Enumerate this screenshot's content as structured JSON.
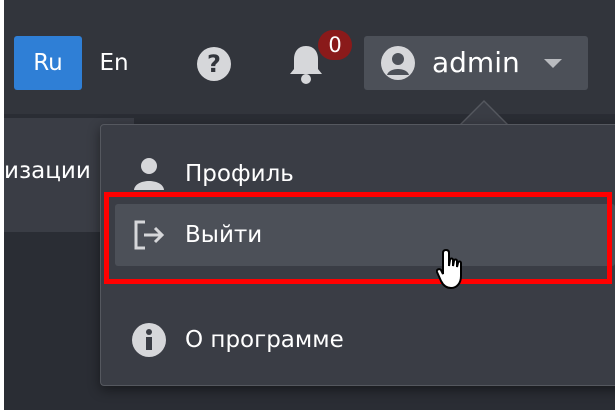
{
  "navbar": {
    "lang_ru": "Ru",
    "lang_en": "En",
    "help_icon": "question-circle-icon",
    "bell_icon": "bell-icon",
    "notification_count": "0",
    "user_name": "admin"
  },
  "subbar": {
    "tab_partial_text": "изации"
  },
  "dropdown": {
    "items": [
      {
        "label": "Профиль",
        "icon": "user-icon"
      },
      {
        "label": "Выйти",
        "icon": "sign-out-icon"
      },
      {
        "label": "О программе",
        "icon": "info-circle-icon"
      }
    ]
  },
  "colors": {
    "navbar_bg": "#32353c",
    "active_lang": "#2f7fd6",
    "badge": "#8a1a1a",
    "dropdown_bg": "#3a3d45",
    "highlight": "#ff0000"
  }
}
